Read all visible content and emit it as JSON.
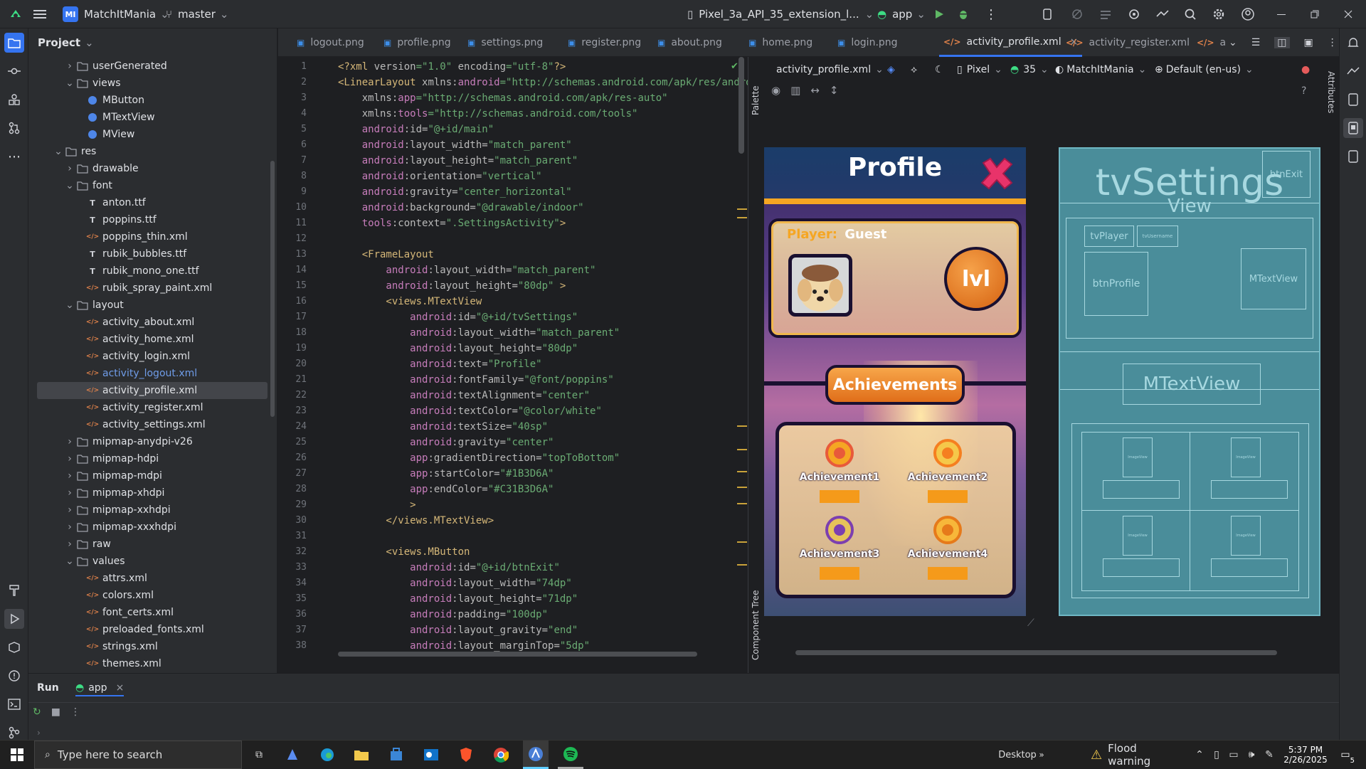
{
  "titlebar": {
    "project_badge": "MI",
    "project_name": "MatchItMania",
    "branch": "master",
    "device": "Pixel_3a_API_35_extension_l...",
    "run_config": "app"
  },
  "sidebar_project": {
    "title": "Project",
    "items": [
      {
        "label": "userGenerated",
        "type": "folder",
        "depth": 2,
        "expanded": false
      },
      {
        "label": "views",
        "type": "folder",
        "depth": 2,
        "expanded": true
      },
      {
        "label": "MButton",
        "type": "class",
        "depth": 3
      },
      {
        "label": "MTextView",
        "type": "class",
        "depth": 3
      },
      {
        "label": "MView",
        "type": "class",
        "depth": 3
      },
      {
        "label": "res",
        "type": "folder",
        "depth": 1,
        "expanded": true
      },
      {
        "label": "drawable",
        "type": "folder",
        "depth": 2,
        "expanded": false
      },
      {
        "label": "font",
        "type": "folder",
        "depth": 2,
        "expanded": true
      },
      {
        "label": "anton.ttf",
        "type": "font",
        "depth": 3
      },
      {
        "label": "poppins.ttf",
        "type": "font",
        "depth": 3
      },
      {
        "label": "poppins_thin.xml",
        "type": "xml",
        "depth": 3
      },
      {
        "label": "rubik_bubbles.ttf",
        "type": "font",
        "depth": 3
      },
      {
        "label": "rubik_mono_one.ttf",
        "type": "font",
        "depth": 3
      },
      {
        "label": "rubik_spray_paint.xml",
        "type": "xml",
        "depth": 3
      },
      {
        "label": "layout",
        "type": "folder",
        "depth": 2,
        "expanded": true
      },
      {
        "label": "activity_about.xml",
        "type": "xml",
        "depth": 3
      },
      {
        "label": "activity_home.xml",
        "type": "xml",
        "depth": 3
      },
      {
        "label": "activity_login.xml",
        "type": "xml",
        "depth": 3
      },
      {
        "label": "activity_logout.xml",
        "type": "xml",
        "depth": 3,
        "modified": true
      },
      {
        "label": "activity_profile.xml",
        "type": "xml",
        "depth": 3,
        "selected": true
      },
      {
        "label": "activity_register.xml",
        "type": "xml",
        "depth": 3
      },
      {
        "label": "activity_settings.xml",
        "type": "xml",
        "depth": 3
      },
      {
        "label": "mipmap-anydpi-v26",
        "type": "folder",
        "depth": 2,
        "expanded": false
      },
      {
        "label": "mipmap-hdpi",
        "type": "folder",
        "depth": 2,
        "expanded": false
      },
      {
        "label": "mipmap-mdpi",
        "type": "folder",
        "depth": 2,
        "expanded": false
      },
      {
        "label": "mipmap-xhdpi",
        "type": "folder",
        "depth": 2,
        "expanded": false
      },
      {
        "label": "mipmap-xxhdpi",
        "type": "folder",
        "depth": 2,
        "expanded": false
      },
      {
        "label": "mipmap-xxxhdpi",
        "type": "folder",
        "depth": 2,
        "expanded": false
      },
      {
        "label": "raw",
        "type": "folder",
        "depth": 2,
        "expanded": false
      },
      {
        "label": "values",
        "type": "folder",
        "depth": 2,
        "expanded": true
      },
      {
        "label": "attrs.xml",
        "type": "xml",
        "depth": 3
      },
      {
        "label": "colors.xml",
        "type": "xml",
        "depth": 3
      },
      {
        "label": "font_certs.xml",
        "type": "xml",
        "depth": 3
      },
      {
        "label": "preloaded_fonts.xml",
        "type": "xml",
        "depth": 3
      },
      {
        "label": "strings.xml",
        "type": "xml",
        "depth": 3
      },
      {
        "label": "themes.xml",
        "type": "xml",
        "depth": 3
      }
    ]
  },
  "editor_tabs": [
    {
      "label": "logout.png",
      "kind": "img"
    },
    {
      "label": "profile.png",
      "kind": "img"
    },
    {
      "label": "settings.png",
      "kind": "img"
    },
    {
      "label": "register.png",
      "kind": "img"
    },
    {
      "label": "about.png",
      "kind": "img"
    },
    {
      "label": "home.png",
      "kind": "img"
    },
    {
      "label": "login.png",
      "kind": "img"
    },
    {
      "label": "activity_profile.xml",
      "kind": "xml",
      "active": true
    },
    {
      "label": "activity_register.xml",
      "kind": "xml"
    },
    {
      "label": "a",
      "kind": "xml"
    }
  ],
  "code_lines": [
    [
      [
        "t",
        "<?xml "
      ],
      [
        "a",
        "version"
      ],
      [
        "v",
        "=\"1.0\" "
      ],
      [
        "a",
        "encoding"
      ],
      [
        "v",
        "=\"utf-8\""
      ],
      [
        "t",
        "?>"
      ]
    ],
    [
      [
        "t",
        "<LinearLayout "
      ],
      [
        "a",
        "xmlns:"
      ],
      [
        "ns",
        "android"
      ],
      [
        "v",
        "=\"http://schemas.android.com/apk/res/android\""
      ]
    ],
    [
      [
        "a",
        "    xmlns:"
      ],
      [
        "ns",
        "app"
      ],
      [
        "v",
        "=\"http://schemas.android.com/apk/res-auto\""
      ]
    ],
    [
      [
        "a",
        "    xmlns:"
      ],
      [
        "ns",
        "tools"
      ],
      [
        "v",
        "=\"http://schemas.android.com/tools\""
      ]
    ],
    [
      [
        "ns",
        "    android"
      ],
      [
        "a",
        ":id="
      ],
      [
        "v",
        "\"@+id/main\""
      ]
    ],
    [
      [
        "ns",
        "    android"
      ],
      [
        "a",
        ":layout_width="
      ],
      [
        "v",
        "\"match_parent\""
      ]
    ],
    [
      [
        "ns",
        "    android"
      ],
      [
        "a",
        ":layout_height="
      ],
      [
        "v",
        "\"match_parent\""
      ]
    ],
    [
      [
        "ns",
        "    android"
      ],
      [
        "a",
        ":orientation="
      ],
      [
        "v",
        "\"vertical\""
      ]
    ],
    [
      [
        "ns",
        "    android"
      ],
      [
        "a",
        ":gravity="
      ],
      [
        "v",
        "\"center_horizontal\""
      ]
    ],
    [
      [
        "ns",
        "    android"
      ],
      [
        "a",
        ":background="
      ],
      [
        "v",
        "\"@drawable/indoor\""
      ]
    ],
    [
      [
        "ns",
        "    tools"
      ],
      [
        "a",
        ":context="
      ],
      [
        "v",
        "\".SettingsActivity\""
      ],
      [
        "t",
        ">"
      ]
    ],
    [],
    [
      [
        "t",
        "    <FrameLayout"
      ]
    ],
    [
      [
        "ns",
        "        android"
      ],
      [
        "a",
        ":layout_width="
      ],
      [
        "v",
        "\"match_parent\""
      ]
    ],
    [
      [
        "ns",
        "        android"
      ],
      [
        "a",
        ":layout_height="
      ],
      [
        "v",
        "\"80dp\""
      ],
      [
        "t",
        " >"
      ]
    ],
    [
      [
        "t",
        "        <views.MTextView"
      ]
    ],
    [
      [
        "ns",
        "            android"
      ],
      [
        "a",
        ":id="
      ],
      [
        "v",
        "\"@+id/tvSettings\""
      ]
    ],
    [
      [
        "ns",
        "            android"
      ],
      [
        "a",
        ":layout_width="
      ],
      [
        "v",
        "\"match_parent\""
      ]
    ],
    [
      [
        "ns",
        "            android"
      ],
      [
        "a",
        ":layout_height="
      ],
      [
        "v",
        "\"80dp\""
      ]
    ],
    [
      [
        "ns",
        "            android"
      ],
      [
        "a",
        ":text="
      ],
      [
        "v",
        "\"Profile\""
      ]
    ],
    [
      [
        "ns",
        "            android"
      ],
      [
        "a",
        ":fontFamily="
      ],
      [
        "v",
        "\"@font/poppins\""
      ]
    ],
    [
      [
        "ns",
        "            android"
      ],
      [
        "a",
        ":textAlignment="
      ],
      [
        "v",
        "\"center\""
      ]
    ],
    [
      [
        "ns",
        "            android"
      ],
      [
        "a",
        ":textColor="
      ],
      [
        "v",
        "\"@color/white\""
      ]
    ],
    [
      [
        "ns",
        "            android"
      ],
      [
        "a",
        ":textSize="
      ],
      [
        "v",
        "\"40sp\""
      ]
    ],
    [
      [
        "ns",
        "            android"
      ],
      [
        "a",
        ":gravity="
      ],
      [
        "v",
        "\"center\""
      ]
    ],
    [
      [
        "ns",
        "            app"
      ],
      [
        "a",
        ":gradientDirection="
      ],
      [
        "v",
        "\"topToBottom\""
      ]
    ],
    [
      [
        "ns",
        "            app"
      ],
      [
        "a",
        ":startColor="
      ],
      [
        "v",
        "\"#1B3D6A\""
      ]
    ],
    [
      [
        "ns",
        "            app"
      ],
      [
        "a",
        ":endColor="
      ],
      [
        "v",
        "\"#C31B3D6A\""
      ]
    ],
    [
      [
        "t",
        "            >"
      ]
    ],
    [
      [
        "t",
        "        </views.MTextView>"
      ]
    ],
    [],
    [
      [
        "t",
        "        <views.MButton"
      ]
    ],
    [
      [
        "ns",
        "            android"
      ],
      [
        "a",
        ":id="
      ],
      [
        "v",
        "\"@+id/btnExit\""
      ]
    ],
    [
      [
        "ns",
        "            android"
      ],
      [
        "a",
        ":layout_width="
      ],
      [
        "v",
        "\"74dp\""
      ]
    ],
    [
      [
        "ns",
        "            android"
      ],
      [
        "a",
        ":layout_height="
      ],
      [
        "v",
        "\"71dp\""
      ]
    ],
    [
      [
        "ns",
        "            android"
      ],
      [
        "a",
        ":padding="
      ],
      [
        "v",
        "\"100dp\""
      ]
    ],
    [
      [
        "ns",
        "            android"
      ],
      [
        "a",
        ":layout_gravity="
      ],
      [
        "v",
        "\"end\""
      ]
    ],
    [
      [
        "ns",
        "            android"
      ],
      [
        "a",
        ":layout_marginTop="
      ],
      [
        "v",
        "\"5dp\""
      ]
    ]
  ],
  "design_toolbar": {
    "file": "activity_profile.xml",
    "device": "Pixel",
    "api": "35",
    "theme": "MatchItMania",
    "locale": "Default (en-us)"
  },
  "side_labels": {
    "palette": "Palette",
    "component_tree": "Component Tree",
    "attributes": "Attributes"
  },
  "phone_preview": {
    "title": "Profile",
    "player_label": "Player:",
    "player_name": "Guest",
    "level": "lvl",
    "achievements_title": "Achievements",
    "achievements": [
      "Achievement1",
      "Achievement2",
      "Achievement3",
      "Achievement4"
    ]
  },
  "blueprint": {
    "title": "tvSettings",
    "sub": "View",
    "btn_exit": "btnExit",
    "tv_player": "tvPlayer",
    "tv_username": "tvUsername",
    "btn_profile": "btnProfile",
    "mtextview": "MTextView",
    "mview_overlap": "MTextView",
    "image_label": "ImageView"
  },
  "run_panel": {
    "tab": "Run",
    "config": "app"
  },
  "taskbar": {
    "search_placeholder": "Type here to search",
    "desktop": "Desktop",
    "weather": "Flood warning",
    "time": "5:37 PM",
    "date": "2/26/2025",
    "notif_count": "5"
  },
  "colors": {
    "accent": "#3574f0",
    "bg": "#1e1f22",
    "panel": "#2b2d30",
    "orange": "#f5a623",
    "blueprint": "#4a8d9a"
  }
}
